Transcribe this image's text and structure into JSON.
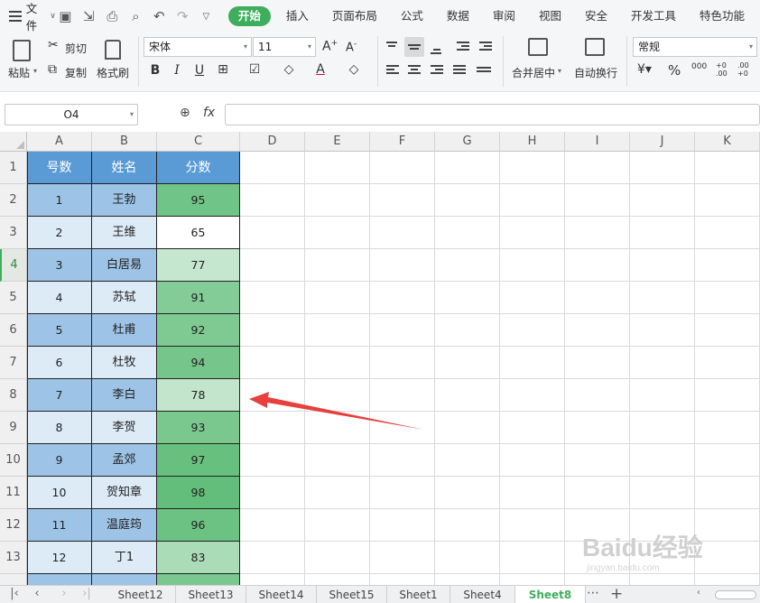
{
  "menubar": {
    "file": "文件",
    "tabs": [
      "开始",
      "插入",
      "页面布局",
      "公式",
      "数据",
      "审阅",
      "视图",
      "安全",
      "开发工具",
      "特色功能"
    ],
    "active_tab": "开始"
  },
  "ribbon": {
    "paste": "粘贴",
    "cut": "剪切",
    "copy": "复制",
    "format_painter": "格式刷",
    "font_name": "宋体",
    "font_size": "11",
    "merge_center": "合并居中",
    "auto_wrap": "自动换行",
    "number_format": "常规",
    "bold": "B",
    "italic": "I",
    "underline": "U",
    "percent": "%",
    "thousands": "000",
    "inc_decimal": "+0 .00",
    "dec_decimal": ".00 +0"
  },
  "formula_bar": {
    "name_box": "O4",
    "fx": "fx",
    "formula": ""
  },
  "columns": [
    "A",
    "B",
    "C",
    "D",
    "E",
    "F",
    "G",
    "H",
    "I",
    "J",
    "K"
  ],
  "row_numbers": [
    "1",
    "2",
    "3",
    "4",
    "5",
    "6",
    "7",
    "8",
    "9",
    "10",
    "11",
    "12",
    "13"
  ],
  "active_row": "4",
  "table": {
    "headers": [
      "号数",
      "姓名",
      "分数"
    ],
    "header_color": "#5b9bd5",
    "rows": [
      {
        "num": "1",
        "name": "王勃",
        "score": "95"
      },
      {
        "num": "2",
        "name": "王维",
        "score": "65"
      },
      {
        "num": "3",
        "name": "白居易",
        "score": "77"
      },
      {
        "num": "4",
        "name": "苏轼",
        "score": "91"
      },
      {
        "num": "5",
        "name": "杜甫",
        "score": "92"
      },
      {
        "num": "6",
        "name": "杜牧",
        "score": "94"
      },
      {
        "num": "7",
        "name": "李白",
        "score": "78"
      },
      {
        "num": "8",
        "name": "李贺",
        "score": "93"
      },
      {
        "num": "9",
        "name": "孟郊",
        "score": "97"
      },
      {
        "num": "10",
        "name": "贺知章",
        "score": "98"
      },
      {
        "num": "11",
        "name": "温庭筠",
        "score": "96"
      },
      {
        "num": "12",
        "name": "丁1",
        "score": "83"
      }
    ],
    "scale_colors": {
      "min": "#ffffff",
      "max": "#63be7b"
    },
    "band_colors": [
      "#9dc3e6",
      "#ddebf7"
    ]
  },
  "arrow_color": "#e8403c",
  "sheets": [
    "Sheet12",
    "Sheet13",
    "Sheet14",
    "Sheet15",
    "Sheet1",
    "Sheet4",
    "Sheet8"
  ],
  "active_sheet": "Sheet8",
  "watermark": {
    "logo": "Baidu经验",
    "url": "jingyan.baidu.com"
  }
}
